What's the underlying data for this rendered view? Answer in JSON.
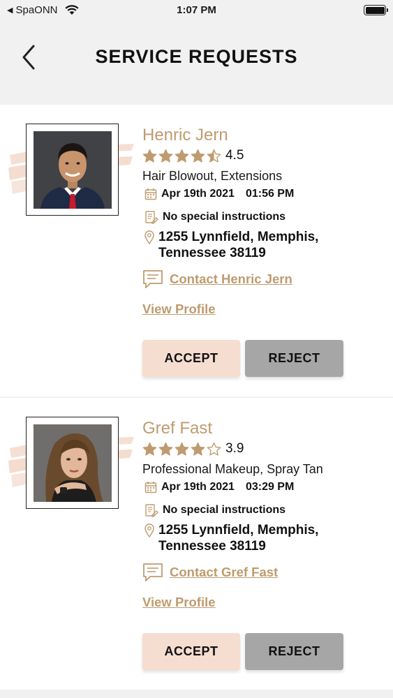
{
  "status_bar": {
    "carrier": "SpaONN",
    "time": "1:07 PM"
  },
  "header": {
    "title": "SERVICE REQUESTS"
  },
  "colors": {
    "accent": "#bf9b6f",
    "accept": "#f5ddd0",
    "reject": "#a7a6a7",
    "header_bg": "#f2f1f1"
  },
  "requests": [
    {
      "name": "Henric Jern",
      "rating": "4.5",
      "rating_value": 4.5,
      "services": "Hair Blowout, Extensions",
      "date": "Apr 19th 2021",
      "time": "01:56 PM",
      "instructions": "No special instructions",
      "address": "1255 Lynnfield, Memphis, Tennessee 38119",
      "contact_label": "Contact Henric Jern",
      "view_profile": "View Profile",
      "accept": "ACCEPT",
      "reject": "REJECT"
    },
    {
      "name": "Gref Fast",
      "rating": "3.9",
      "rating_value": 3.9,
      "services": "Professional Makeup, Spray Tan",
      "date": "Apr 19th 2021",
      "time": "03:29 PM",
      "instructions": "No special instructions",
      "address": "1255 Lynnfield, Memphis, Tennessee 38119",
      "contact_label": "Contact Gref Fast",
      "view_profile": "View Profile",
      "accept": "ACCEPT",
      "reject": "REJECT"
    }
  ]
}
